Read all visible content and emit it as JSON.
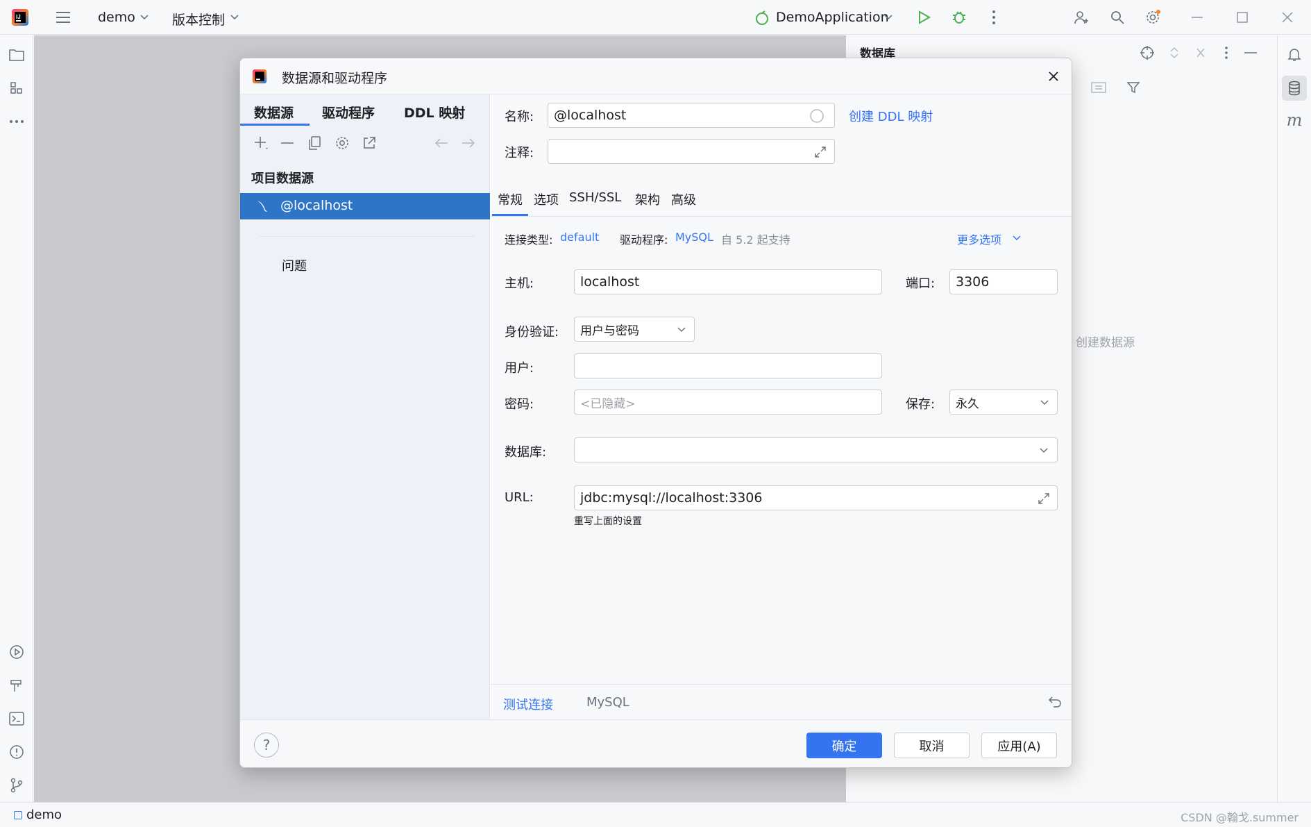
{
  "titlebar": {
    "project": "demo",
    "vcs": "版本控制",
    "run_config": "DemoApplication"
  },
  "db_panel": {
    "title": "数据库",
    "empty_hint": "创建数据源"
  },
  "statusbar": {
    "project": "demo",
    "watermark": "CSDN @翰戈.summer"
  },
  "dialog": {
    "title": "数据源和驱动程序",
    "left_tabs": [
      "数据源",
      "驱动程序",
      "DDL 映射"
    ],
    "section_title": "项目数据源",
    "selected_source": "@localhost",
    "problems": "问题",
    "name_label": "名称:",
    "name_value": "@localhost",
    "create_ddl": "创建 DDL 映射",
    "comment_label": "注释:",
    "comment_value": "",
    "tabs": [
      "常规",
      "选项",
      "SSH/SSL",
      "架构",
      "高级"
    ],
    "conn_type_label": "连接类型:",
    "conn_type_value": "default",
    "driver_label": "驱动程序:",
    "driver_value": "MySQL",
    "driver_note": "自 5.2 起支持",
    "more_options": "更多选项",
    "host_label": "主机:",
    "host_value": "localhost",
    "port_label": "端口:",
    "port_value": "3306",
    "auth_label": "身份验证:",
    "auth_value": "用户与密码",
    "user_label": "用户:",
    "user_value": "",
    "password_label": "密码:",
    "password_placeholder": "<已隐藏>",
    "save_label": "保存:",
    "save_value": "永久",
    "database_label": "数据库:",
    "database_value": "",
    "url_label": "URL:",
    "url_value": "jdbc:mysql://localhost:3306",
    "url_hint": "重写上面的设置",
    "test_connection": "测试连接",
    "bottom_driver": "MySQL",
    "ok": "确定",
    "cancel": "取消",
    "apply": "应用(A)"
  },
  "colors": {
    "accent": "#3574f0",
    "selection": "#2e75c8",
    "run_green": "#4caf50"
  }
}
